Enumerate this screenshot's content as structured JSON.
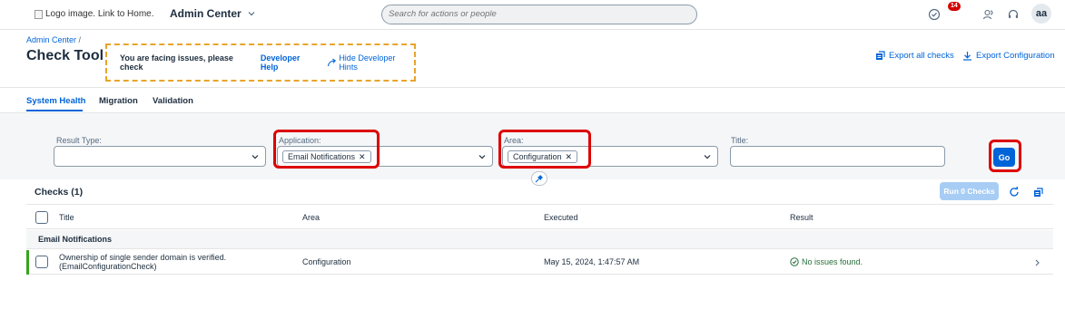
{
  "shell": {
    "logo_alt": "Logo image. Link to Home.",
    "app_title": "Admin Center",
    "search_placeholder": "Search for actions or people",
    "notification_count": "14",
    "avatar_initials": "aa"
  },
  "header": {
    "breadcrumb": "Admin Center",
    "breadcrumb_sep": "/",
    "title": "Check Tool",
    "hint_text": "You are facing issues, please check",
    "developer_help": "Developer Help",
    "hide_hints": "Hide Developer Hints",
    "export_all": "Export all checks",
    "export_config": "Export Configuration"
  },
  "tabs": [
    {
      "label": "System Health",
      "active": true
    },
    {
      "label": "Migration",
      "active": false
    },
    {
      "label": "Validation",
      "active": false
    }
  ],
  "filters": {
    "result_type": {
      "label": "Result Type:",
      "value": ""
    },
    "application": {
      "label": "Application:",
      "token": "Email Notifications"
    },
    "area": {
      "label": "Area:",
      "token": "Configuration"
    },
    "title": {
      "label": "Title:",
      "value": ""
    },
    "go_label": "Go"
  },
  "table": {
    "title": "Checks (1)",
    "run_label": "Run 0 Checks",
    "columns": [
      "Title",
      "Area",
      "Executed",
      "Result"
    ],
    "group": "Email Notifications",
    "rows": [
      {
        "title_line1": "Ownership of single sender domain is verified.",
        "title_line2": "(EmailConfigurationCheck)",
        "area": "Configuration",
        "executed": "May 15, 2024, 1:47:57 AM",
        "result": "No issues found."
      }
    ]
  },
  "colors": {
    "accent": "#0064d9",
    "highlight_red": "#dd0000",
    "hint_border": "#e9a42b",
    "success": "#256f3a"
  }
}
